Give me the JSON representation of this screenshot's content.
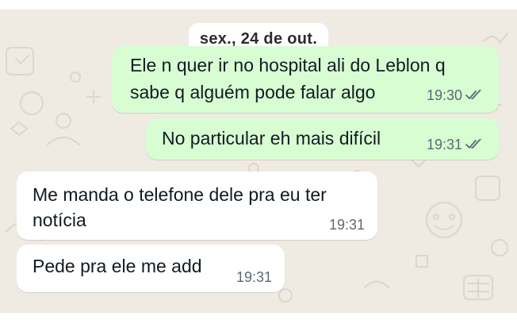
{
  "chat": {
    "date_label": "sex., 24 de out.",
    "messages": [
      {
        "direction": "outgoing",
        "lines": [
          "Ele n quer ir no hospital ali do Leblon q",
          "sabe q alguém pode falar algo"
        ],
        "time": "19:30",
        "status_icon": "double-check-icon"
      },
      {
        "direction": "outgoing",
        "lines": [
          "No particular eh mais difícil"
        ],
        "time": "19:31",
        "status_icon": "double-check-icon"
      },
      {
        "direction": "incoming",
        "lines": [
          "Me manda o telefone dele pra eu ter",
          "notícia"
        ],
        "time": "19:31"
      },
      {
        "direction": "incoming",
        "lines": [
          "Pede pra ele me add"
        ],
        "time": "19:31"
      }
    ]
  },
  "colors": {
    "wallpaper": "#efeae2",
    "outgoing_bubble": "#d9fdd3",
    "incoming_bubble": "#ffffff",
    "meta_text": "#5c6a72"
  }
}
